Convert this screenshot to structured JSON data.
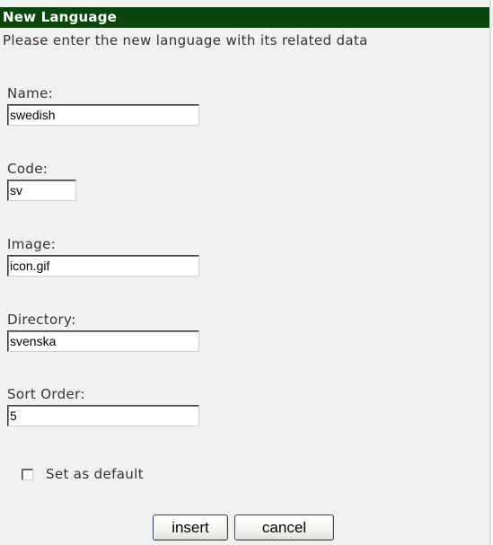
{
  "dialog": {
    "title": "New Language",
    "intro": "Please enter the new language with its related data"
  },
  "form": {
    "name": {
      "label": "Name:",
      "value": "swedish"
    },
    "code": {
      "label": "Code:",
      "value": "sv"
    },
    "image": {
      "label": "Image:",
      "value": "icon.gif"
    },
    "directory": {
      "label": "Directory:",
      "value": "svenska"
    },
    "sort_order": {
      "label": "Sort Order:",
      "value": "5"
    },
    "set_default": {
      "label": "Set as default",
      "checked": false
    }
  },
  "buttons": {
    "insert": "insert",
    "cancel": "cancel"
  }
}
